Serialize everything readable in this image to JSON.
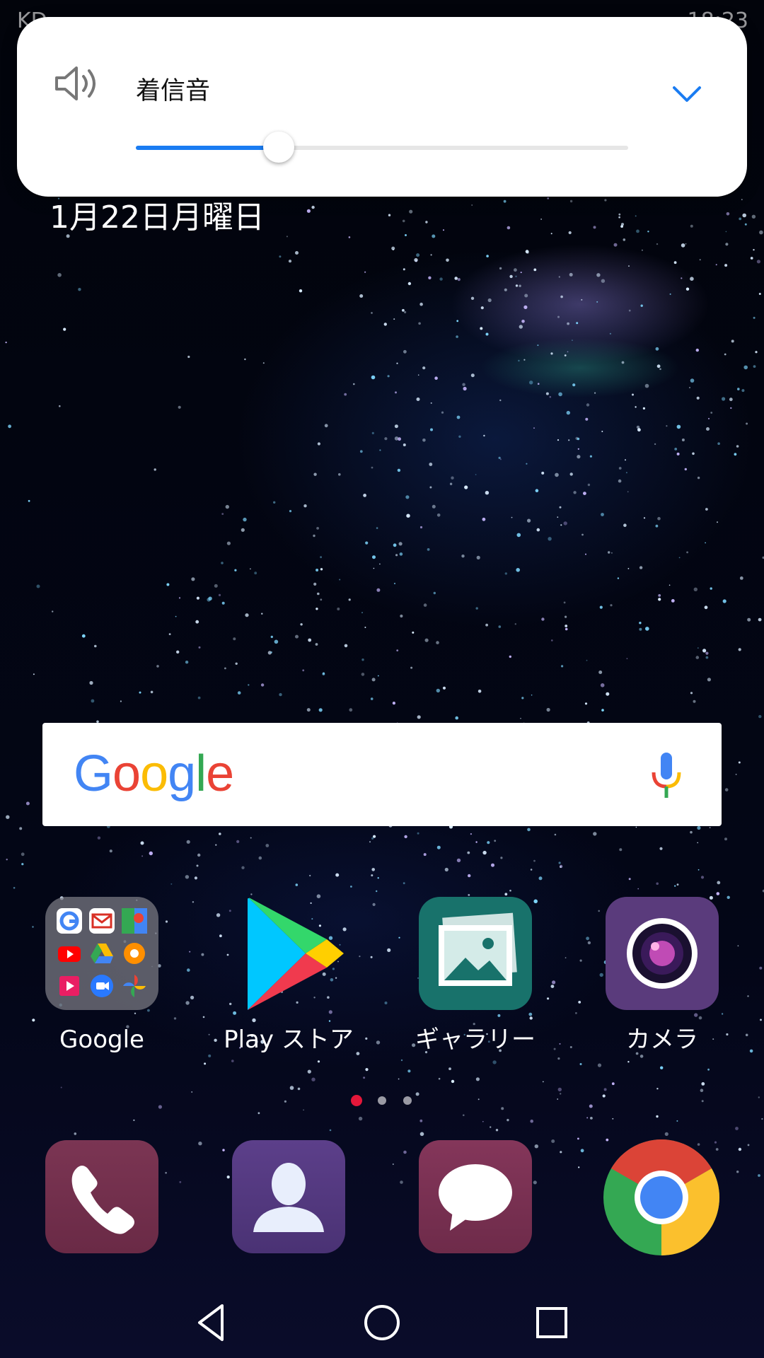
{
  "status_bar": {
    "left_text": "KD",
    "right_text": "18:23"
  },
  "volume_panel": {
    "label": "着信音",
    "level_fraction": 0.29,
    "accent_color": "#1a7cf2",
    "icon": "speaker-icon",
    "expand_icon": "chevron-down-icon"
  },
  "date": "1月22日月曜日",
  "search": {
    "logo_letters": [
      "G",
      "o",
      "o",
      "g",
      "l",
      "e"
    ],
    "logo_colors": [
      "#4285F4",
      "#EA4335",
      "#FBBC05",
      "#4285F4",
      "#34A853",
      "#EA4335"
    ],
    "icon": "mic-icon"
  },
  "apps": [
    {
      "id": "google-folder",
      "label": "Google"
    },
    {
      "id": "play-store",
      "label": "Play ストア"
    },
    {
      "id": "gallery",
      "label": "ギャラリー"
    },
    {
      "id": "camera",
      "label": "カメラ"
    }
  ],
  "page_indicator": {
    "count": 3,
    "active_index": 0
  },
  "dock": [
    {
      "id": "phone",
      "icon": "phone-icon"
    },
    {
      "id": "contacts",
      "icon": "contacts-icon"
    },
    {
      "id": "messages",
      "icon": "messages-icon"
    },
    {
      "id": "chrome",
      "icon": "chrome-icon"
    }
  ],
  "nav": [
    "back-icon",
    "home-icon",
    "recents-icon"
  ]
}
